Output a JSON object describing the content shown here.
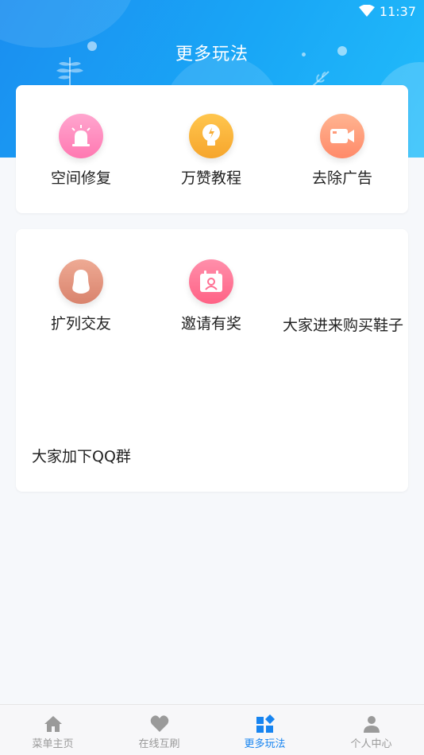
{
  "status": {
    "time": "11:37"
  },
  "header": {
    "title": "更多玩法"
  },
  "card1": {
    "items": [
      {
        "label": "空间修复",
        "icon": "alarm-light-icon",
        "color": "#ff86bd"
      },
      {
        "label": "万赞教程",
        "icon": "lightbulb-icon",
        "color": "#f8b43a"
      },
      {
        "label": "去除广告",
        "icon": "video-camera-icon",
        "color": "#ff9a78"
      }
    ]
  },
  "card2": {
    "items": [
      {
        "label": "扩列交友",
        "icon": "qq-penguin-icon",
        "color": "#e39680"
      },
      {
        "label": "邀请有奖",
        "icon": "calendar-person-icon",
        "color": "#ff7093"
      },
      {
        "label": "大家进来购买鞋子",
        "icon": "none"
      },
      {
        "label": "大家加下QQ群",
        "icon": "none"
      }
    ]
  },
  "tabbar": {
    "tabs": [
      {
        "label": "菜单主页",
        "icon": "home-icon",
        "active": false
      },
      {
        "label": "在线互刷",
        "icon": "heart-icon",
        "active": false
      },
      {
        "label": "更多玩法",
        "icon": "grid-icon",
        "active": true
      },
      {
        "label": "个人中心",
        "icon": "person-icon",
        "active": false
      }
    ],
    "active_color": "#1784f0",
    "inactive_color": "#999999"
  }
}
